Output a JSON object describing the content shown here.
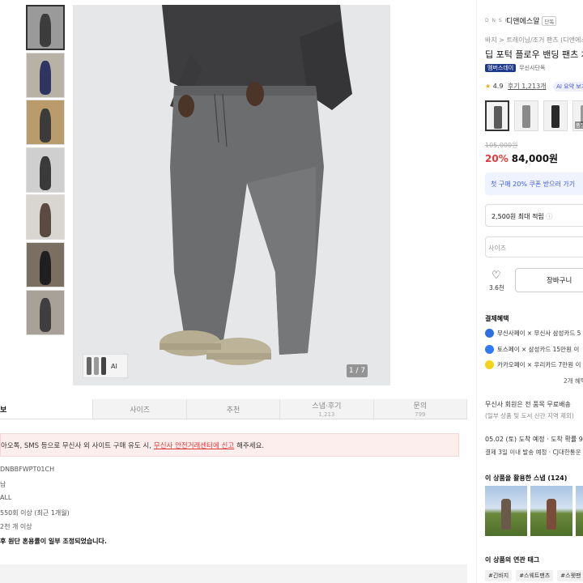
{
  "thumbnails": [
    {
      "bg": "#9a9a9a",
      "fig": "#3c3c3c"
    },
    {
      "bg": "#b8b2a6",
      "fig": "#2e3560"
    },
    {
      "bg": "#b99c6a",
      "fig": "#3b3b3b"
    },
    {
      "bg": "#cfcfcf",
      "fig": "#3a3a3a"
    },
    {
      "bg": "#d9d6cf",
      "fig": "#5a4a42"
    },
    {
      "bg": "#7b6f63",
      "fig": "#1f1f1f"
    },
    {
      "bg": "#a7a198",
      "fig": "#3f3f3f"
    }
  ],
  "main_image": {
    "ai_label": "AI",
    "counter": "1 / 7"
  },
  "tabs": [
    {
      "label": "보",
      "sub": ""
    },
    {
      "label": "사이즈",
      "sub": ""
    },
    {
      "label": "추천",
      "sub": ""
    },
    {
      "label": "스냅·후기",
      "sub": "1,213"
    },
    {
      "label": "문의",
      "sub": "799"
    }
  ],
  "notice": {
    "text_before": "아오톡, SMS 등으로 무신사 외 사이트 구매 유도 시,",
    "link": "무신사 안전거래센터에 신고",
    "text_after": "해주세요."
  },
  "info_lines": [
    "DNBBFWPT01CH",
    "남",
    "ALL",
    "550회 이상 (최근 1개월)",
    "2천 개 이상"
  ],
  "info_bold": "후 원단 혼용률이 일부 조정되었습니다.",
  "right": {
    "brand_logo": "D N S H",
    "brand_name": "디앤에스알",
    "brand_badge": "단독",
    "breadcrumb": "바지 > 트레이닝/조거 팬츠 (디앤에스",
    "title": "딥 포턱 플로우 밴딩 팬츠 차",
    "badge_member": "멤버스데이",
    "badge_exclusive": "무신사단독",
    "rating": "4.9",
    "reviews": "후기 1,213개",
    "ai_summary": "AI 요약 보기",
    "options": [
      {
        "color": "#5a5a5a",
        "tag": ""
      },
      {
        "color": "#8a8a8a",
        "tag": ""
      },
      {
        "color": "#2a2a2a",
        "tag": ""
      },
      {
        "color": "#9a9a9a",
        "tag": "품절"
      }
    ],
    "original_price": "105,000원",
    "discount": "20%",
    "price": "84,000원",
    "coupon": "첫 구매 20% 쿠폰 받으러 가기",
    "points": "2,500원 최대 적립",
    "size_placeholder": "사이즈",
    "likes": "3.6천",
    "cart": "장바구니",
    "benefit_title": "결제혜택",
    "benefits": [
      {
        "text": "무신사페이 × 무신사 삼성카드 5",
        "color": "#2f6fe0"
      },
      {
        "text": "토스페이 × 삼성카드 15만원 이",
        "color": "#2d7cf6"
      },
      {
        "text": "카카오페이 × 우리카드 7만원 이",
        "color": "#f6d31b"
      }
    ],
    "more_benefits": "2개 혜택",
    "shipping": "무신사 회원은 전 품목 무료배송",
    "shipping_sub": "(일부 상품 및 도서 산간 지역 제외)",
    "delivery_date": "05.02 (토) 도착 예정 · 도착 확률 99",
    "delivery_detail": "결제 3일 이내 발송 예정 · CJ대한통운",
    "snap_title": "이 상품을 활용한 스냅 (124)",
    "tags_title": "이 상품의 연관 태그",
    "tags": [
      "#긴바지",
      "#스웨트팬츠",
      "#스웻팬"
    ]
  }
}
